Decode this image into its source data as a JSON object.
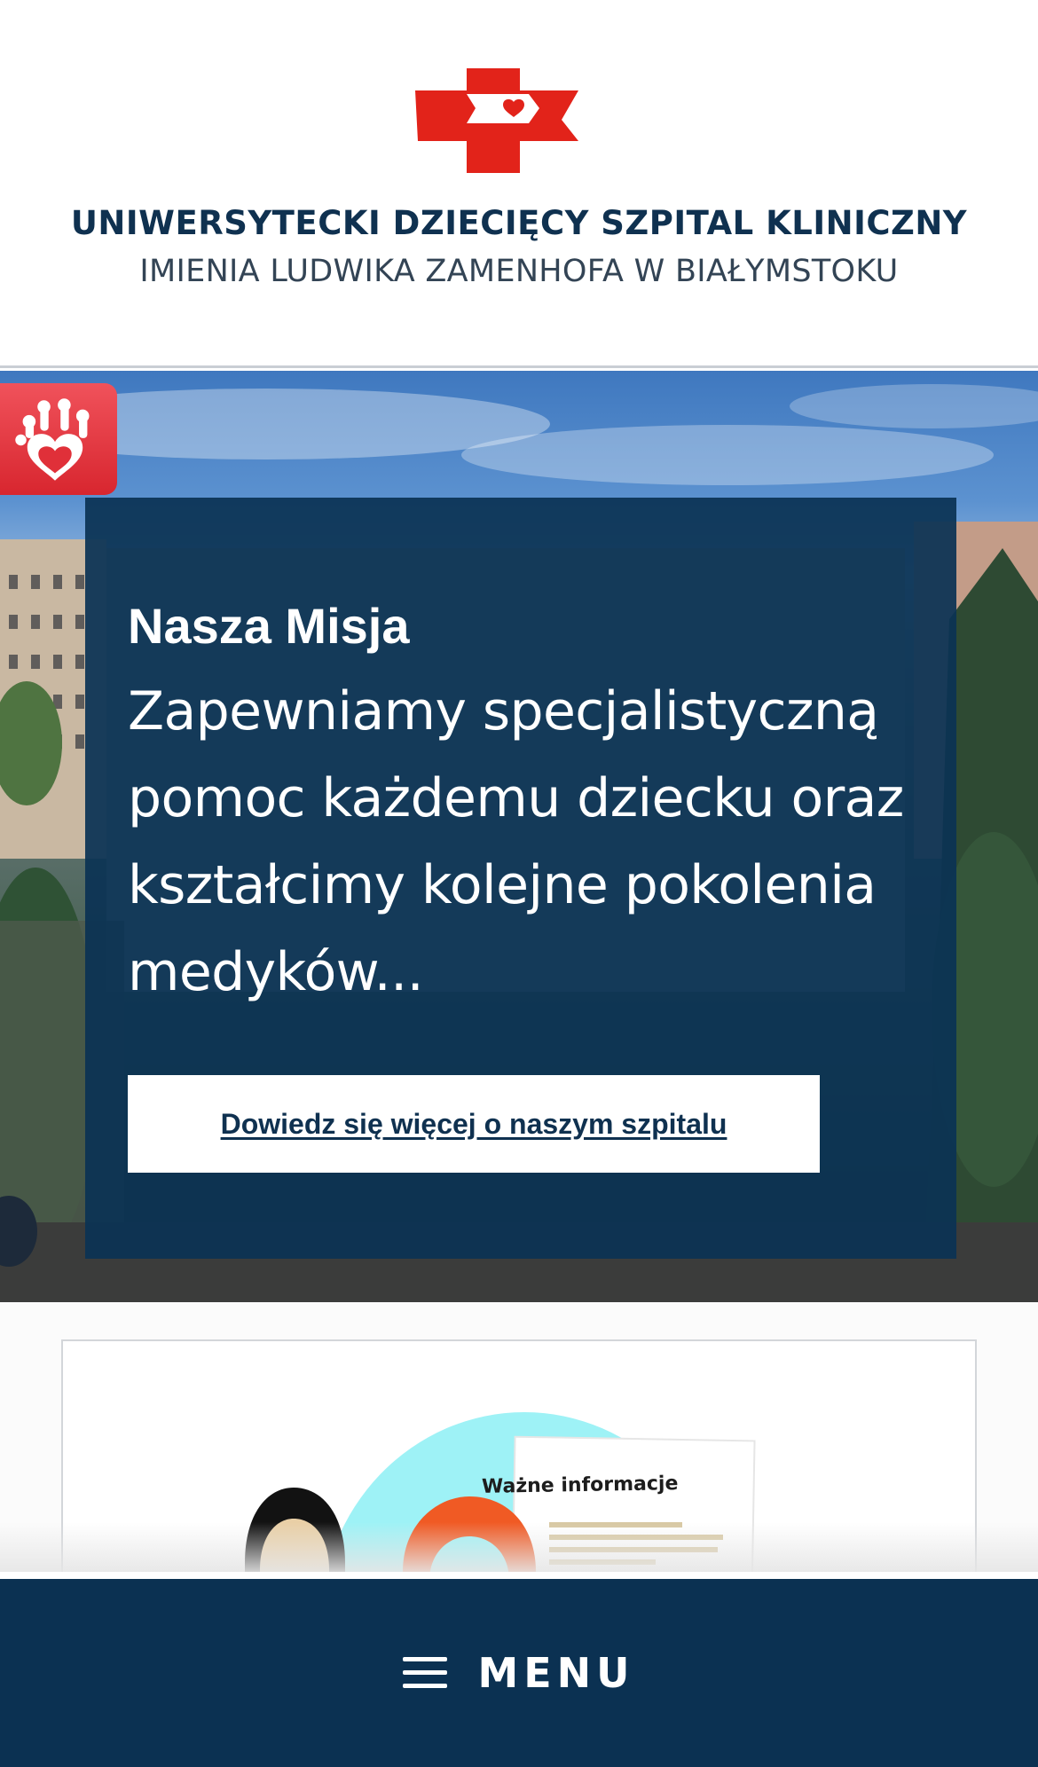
{
  "header": {
    "title": "UNIWERSYTECKI DZIECIĘCY SZPITAL KLINICZNY",
    "subtitle": "IMIENIA LUDWIKA ZAMENHOFA W BIAŁYMSTOKU",
    "logo_icon": "red-cross-heart-logo-icon"
  },
  "hero": {
    "badge_icon": "hand-heart-icon",
    "mission": {
      "title": "Nasza Misja",
      "text": "Zapewniamy specjalistyczną pomoc każdemu dziecku oraz kształcimy kolejne pokolenia medyków...",
      "button_label": "Dowiedz się więcej o naszym szpitalu"
    }
  },
  "info_card": {
    "label": "Ważne informacje"
  },
  "bottom_nav": {
    "menu_label": "MENU",
    "menu_icon": "hamburger-icon"
  },
  "colors": {
    "brand_navy": "#0b3152",
    "brand_red": "#d8262f",
    "accent_cyan": "#9ef2f6",
    "accent_orange": "#f05a24"
  }
}
